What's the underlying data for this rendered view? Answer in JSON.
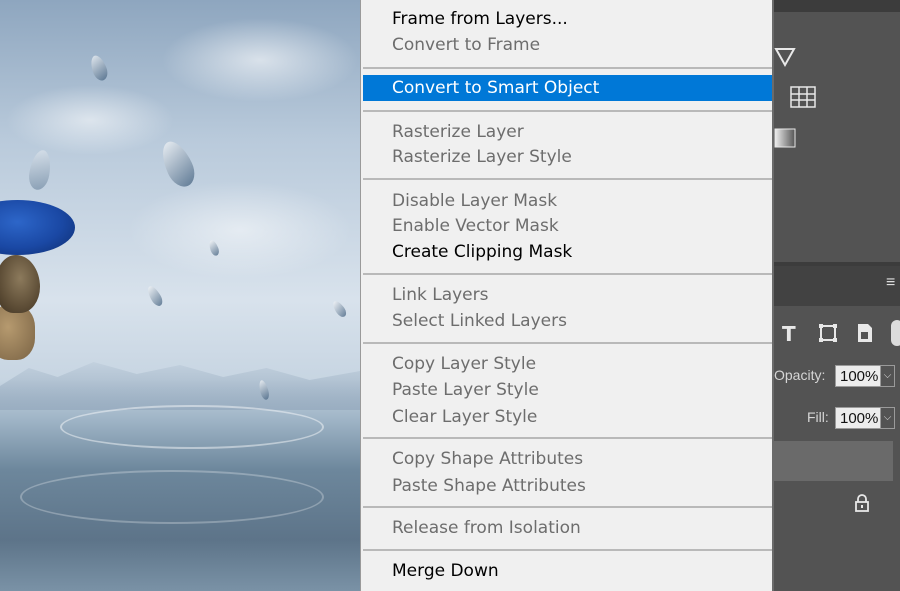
{
  "context_menu": {
    "items": [
      {
        "label": "Frame from Layers...",
        "state": "enabled"
      },
      {
        "label": "Convert to Frame",
        "state": "disabled"
      },
      {
        "label": "Convert to Smart Object",
        "state": "highlighted"
      },
      {
        "label": "Rasterize Layer",
        "state": "disabled"
      },
      {
        "label": "Rasterize Layer Style",
        "state": "disabled"
      },
      {
        "label": "Disable Layer Mask",
        "state": "disabled"
      },
      {
        "label": "Enable Vector Mask",
        "state": "disabled"
      },
      {
        "label": "Create Clipping Mask",
        "state": "enabled"
      },
      {
        "label": "Link Layers",
        "state": "disabled"
      },
      {
        "label": "Select Linked Layers",
        "state": "disabled"
      },
      {
        "label": "Copy Layer Style",
        "state": "disabled"
      },
      {
        "label": "Paste Layer Style",
        "state": "disabled"
      },
      {
        "label": "Clear Layer Style",
        "state": "disabled"
      },
      {
        "label": "Copy Shape Attributes",
        "state": "disabled"
      },
      {
        "label": "Paste Shape Attributes",
        "state": "disabled"
      },
      {
        "label": "Release from Isolation",
        "state": "disabled"
      },
      {
        "label": "Merge Down",
        "state": "enabled"
      }
    ],
    "highlight_color": "#0078d7"
  },
  "layers_panel": {
    "opacity_label": "Opacity:",
    "opacity_value": "100%",
    "fill_label": "Fill:",
    "fill_value": "100%"
  },
  "icons": [
    "triangle-icon",
    "grid-icon",
    "gradient-icon",
    "type-filter-icon",
    "shape-filter-icon",
    "smart-object-filter-icon",
    "lock-icon",
    "panel-menu-icon"
  ]
}
